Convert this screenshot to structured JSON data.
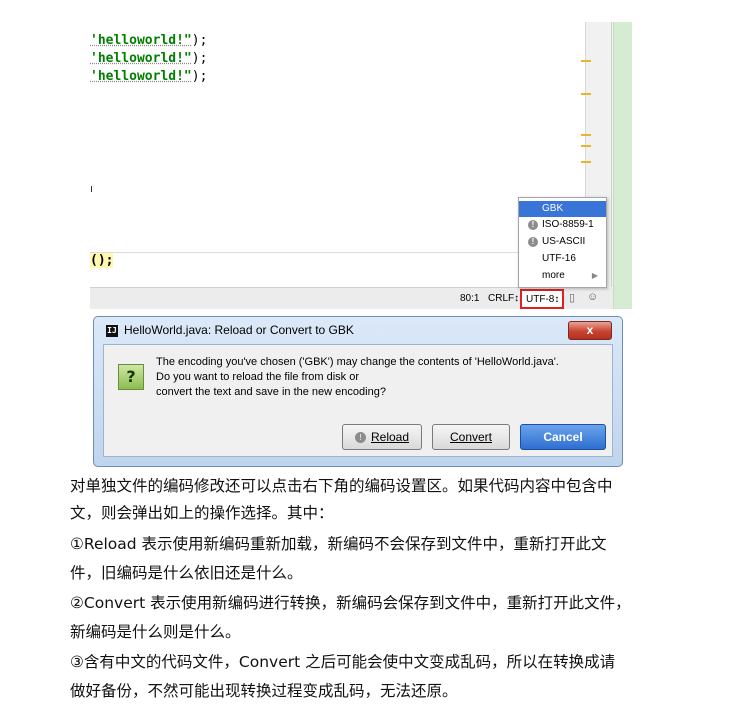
{
  "editor": {
    "code_lines": [
      {
        "str": "'helloworld!\"",
        "rest": ");"
      },
      {
        "str": "'helloworld!\"",
        "rest": ");"
      },
      {
        "str": "'helloworld!\"",
        "rest": ");"
      }
    ],
    "brace_line": "();"
  },
  "statusbar": {
    "position": "80:1",
    "line_separator": "CRLF↕",
    "encoding": "UTF-8↕",
    "lock_icon": "lock-icon",
    "inspector_icon": "hector-icon"
  },
  "encoding_popup": {
    "items": [
      {
        "label": "GBK",
        "selected": true,
        "warn": false
      },
      {
        "label": "ISO-8859-1",
        "selected": false,
        "warn": true
      },
      {
        "label": "US-ASCII",
        "selected": false,
        "warn": true
      },
      {
        "label": "UTF-16",
        "selected": false,
        "warn": false
      },
      {
        "label": "more",
        "selected": false,
        "warn": false,
        "submenu": true
      }
    ]
  },
  "dialog": {
    "title": "HelloWorld.java: Reload or Convert to GBK",
    "close_label": "x",
    "message_lines": [
      "The encoding you've chosen ('GBK') may change the contents of 'HelloWorld.java'.",
      "Do you want to reload the file from disk or",
      "convert the text and save in the new encoding?"
    ],
    "buttons": {
      "reload": "Reload",
      "convert": "Convert",
      "cancel": "Cancel"
    }
  },
  "text": {
    "lines": [
      "对单独文件的编码修改还可以点击右下角的编码设置区。如果代码内容中包含中",
      "文，则会弹出如上的操作选择。其中：",
      "①Reload 表示使用新编码重新加载，新编码不会保存到文件中，重新打开此文",
      "件，旧编码是什么依旧还是什么。",
      "②Convert 表示使用新编码进行转换，新编码会保存到文件中，重新打开此文件，",
      "新编码是什么则是什么。",
      "③含有中文的代码文件，Convert 之后可能会使中文变成乱码，所以在转换成请",
      "做好备份，不然可能出现转换过程变成乱码，无法还原。"
    ]
  },
  "colors": {
    "selection": "#3875d7",
    "string": "#008000",
    "highlight_border": "#e02020",
    "cancel_button": "#2e6fd0"
  }
}
